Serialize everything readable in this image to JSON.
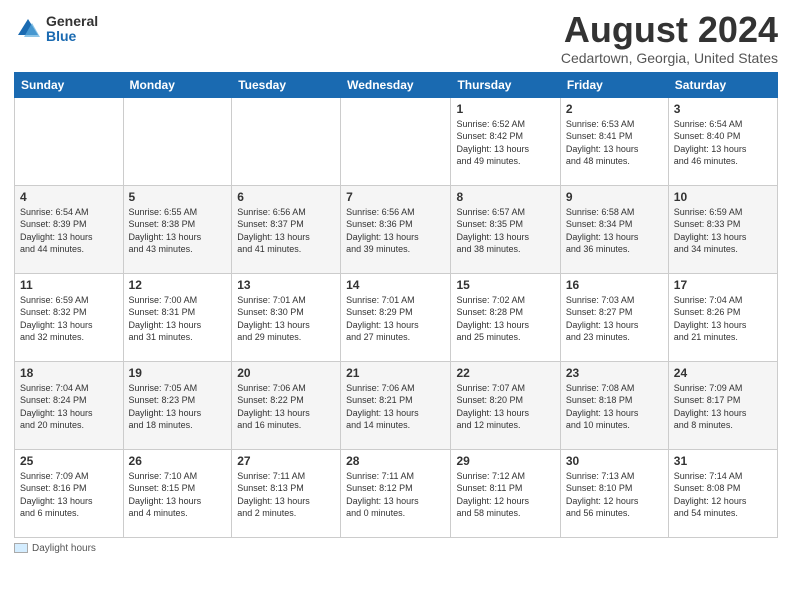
{
  "header": {
    "logo_general": "General",
    "logo_blue": "Blue",
    "main_title": "August 2024",
    "subtitle": "Cedartown, Georgia, United States"
  },
  "days_of_week": [
    "Sunday",
    "Monday",
    "Tuesday",
    "Wednesday",
    "Thursday",
    "Friday",
    "Saturday"
  ],
  "weeks": [
    [
      {
        "day": "",
        "info": ""
      },
      {
        "day": "",
        "info": ""
      },
      {
        "day": "",
        "info": ""
      },
      {
        "day": "",
        "info": ""
      },
      {
        "day": "1",
        "info": "Sunrise: 6:52 AM\nSunset: 8:42 PM\nDaylight: 13 hours\nand 49 minutes."
      },
      {
        "day": "2",
        "info": "Sunrise: 6:53 AM\nSunset: 8:41 PM\nDaylight: 13 hours\nand 48 minutes."
      },
      {
        "day": "3",
        "info": "Sunrise: 6:54 AM\nSunset: 8:40 PM\nDaylight: 13 hours\nand 46 minutes."
      }
    ],
    [
      {
        "day": "4",
        "info": "Sunrise: 6:54 AM\nSunset: 8:39 PM\nDaylight: 13 hours\nand 44 minutes."
      },
      {
        "day": "5",
        "info": "Sunrise: 6:55 AM\nSunset: 8:38 PM\nDaylight: 13 hours\nand 43 minutes."
      },
      {
        "day": "6",
        "info": "Sunrise: 6:56 AM\nSunset: 8:37 PM\nDaylight: 13 hours\nand 41 minutes."
      },
      {
        "day": "7",
        "info": "Sunrise: 6:56 AM\nSunset: 8:36 PM\nDaylight: 13 hours\nand 39 minutes."
      },
      {
        "day": "8",
        "info": "Sunrise: 6:57 AM\nSunset: 8:35 PM\nDaylight: 13 hours\nand 38 minutes."
      },
      {
        "day": "9",
        "info": "Sunrise: 6:58 AM\nSunset: 8:34 PM\nDaylight: 13 hours\nand 36 minutes."
      },
      {
        "day": "10",
        "info": "Sunrise: 6:59 AM\nSunset: 8:33 PM\nDaylight: 13 hours\nand 34 minutes."
      }
    ],
    [
      {
        "day": "11",
        "info": "Sunrise: 6:59 AM\nSunset: 8:32 PM\nDaylight: 13 hours\nand 32 minutes."
      },
      {
        "day": "12",
        "info": "Sunrise: 7:00 AM\nSunset: 8:31 PM\nDaylight: 13 hours\nand 31 minutes."
      },
      {
        "day": "13",
        "info": "Sunrise: 7:01 AM\nSunset: 8:30 PM\nDaylight: 13 hours\nand 29 minutes."
      },
      {
        "day": "14",
        "info": "Sunrise: 7:01 AM\nSunset: 8:29 PM\nDaylight: 13 hours\nand 27 minutes."
      },
      {
        "day": "15",
        "info": "Sunrise: 7:02 AM\nSunset: 8:28 PM\nDaylight: 13 hours\nand 25 minutes."
      },
      {
        "day": "16",
        "info": "Sunrise: 7:03 AM\nSunset: 8:27 PM\nDaylight: 13 hours\nand 23 minutes."
      },
      {
        "day": "17",
        "info": "Sunrise: 7:04 AM\nSunset: 8:26 PM\nDaylight: 13 hours\nand 21 minutes."
      }
    ],
    [
      {
        "day": "18",
        "info": "Sunrise: 7:04 AM\nSunset: 8:24 PM\nDaylight: 13 hours\nand 20 minutes."
      },
      {
        "day": "19",
        "info": "Sunrise: 7:05 AM\nSunset: 8:23 PM\nDaylight: 13 hours\nand 18 minutes."
      },
      {
        "day": "20",
        "info": "Sunrise: 7:06 AM\nSunset: 8:22 PM\nDaylight: 13 hours\nand 16 minutes."
      },
      {
        "day": "21",
        "info": "Sunrise: 7:06 AM\nSunset: 8:21 PM\nDaylight: 13 hours\nand 14 minutes."
      },
      {
        "day": "22",
        "info": "Sunrise: 7:07 AM\nSunset: 8:20 PM\nDaylight: 13 hours\nand 12 minutes."
      },
      {
        "day": "23",
        "info": "Sunrise: 7:08 AM\nSunset: 8:18 PM\nDaylight: 13 hours\nand 10 minutes."
      },
      {
        "day": "24",
        "info": "Sunrise: 7:09 AM\nSunset: 8:17 PM\nDaylight: 13 hours\nand 8 minutes."
      }
    ],
    [
      {
        "day": "25",
        "info": "Sunrise: 7:09 AM\nSunset: 8:16 PM\nDaylight: 13 hours\nand 6 minutes."
      },
      {
        "day": "26",
        "info": "Sunrise: 7:10 AM\nSunset: 8:15 PM\nDaylight: 13 hours\nand 4 minutes."
      },
      {
        "day": "27",
        "info": "Sunrise: 7:11 AM\nSunset: 8:13 PM\nDaylight: 13 hours\nand 2 minutes."
      },
      {
        "day": "28",
        "info": "Sunrise: 7:11 AM\nSunset: 8:12 PM\nDaylight: 13 hours\nand 0 minutes."
      },
      {
        "day": "29",
        "info": "Sunrise: 7:12 AM\nSunset: 8:11 PM\nDaylight: 12 hours\nand 58 minutes."
      },
      {
        "day": "30",
        "info": "Sunrise: 7:13 AM\nSunset: 8:10 PM\nDaylight: 12 hours\nand 56 minutes."
      },
      {
        "day": "31",
        "info": "Sunrise: 7:14 AM\nSunset: 8:08 PM\nDaylight: 12 hours\nand 54 minutes."
      }
    ]
  ],
  "footer": {
    "legend_label": "Daylight hours"
  }
}
